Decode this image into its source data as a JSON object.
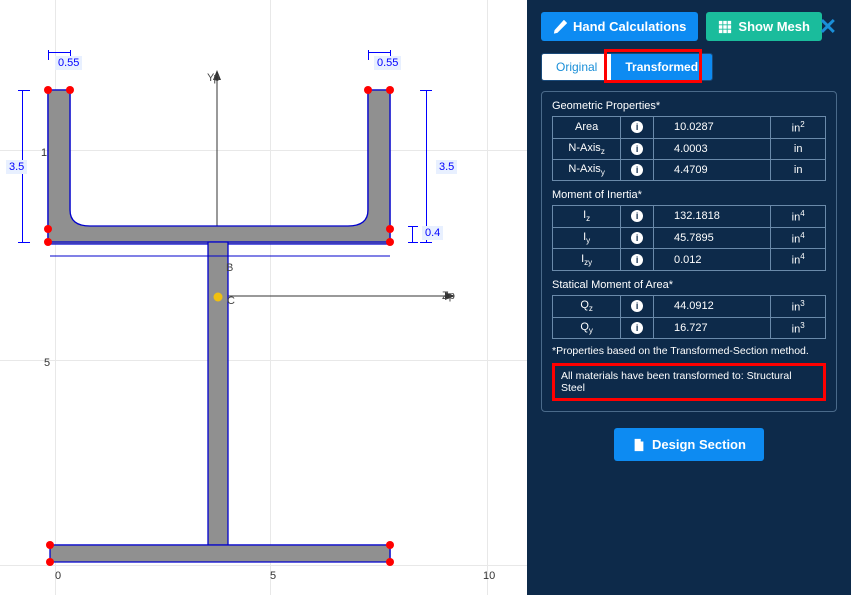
{
  "buttons": {
    "hand_calc": "Hand Calculations",
    "show_mesh": "Show Mesh",
    "design_section": "Design Section"
  },
  "tabs": {
    "original": "Original",
    "transformed": "Transformed"
  },
  "sections": {
    "geometric": {
      "title": "Geometric Properties*",
      "rows": [
        {
          "label": "Area",
          "value": "10.0287",
          "unit": "in²"
        },
        {
          "label": "N-Axis",
          "sub": "z",
          "value": "4.0003",
          "unit": "in"
        },
        {
          "label": "N-Axis",
          "sub": "y",
          "value": "4.4709",
          "unit": "in"
        }
      ]
    },
    "inertia": {
      "title": "Moment of Inertia*",
      "rows": [
        {
          "label": "I",
          "sub": "z",
          "value": "132.1818",
          "unit": "in⁴"
        },
        {
          "label": "I",
          "sub": "y",
          "value": "45.7895",
          "unit": "in⁴"
        },
        {
          "label": "I",
          "sub": "zy",
          "value": "0.012",
          "unit": "in⁴"
        }
      ]
    },
    "statical": {
      "title": "Statical Moment of Area*",
      "rows": [
        {
          "label": "Q",
          "sub": "z",
          "value": "44.0912",
          "unit": "in³"
        },
        {
          "label": "Q",
          "sub": "y",
          "value": "16.727",
          "unit": "in³"
        }
      ]
    }
  },
  "notes": {
    "method": "*Properties based on the Transformed-Section method.",
    "transform": "All materials have been transformed to: Structural Steel"
  },
  "canvas": {
    "axes": {
      "yp": "Yp",
      "zp": "Zp",
      "c": "C",
      "b": "B"
    },
    "ticks": {
      "x0": "0",
      "x5": "5",
      "x10": "10",
      "y5": "5",
      "y10": "10"
    },
    "dims": {
      "top_left": "0.55",
      "top_right": "0.55",
      "left": "3.5",
      "right": "3.5",
      "mid_right": "0.4"
    }
  }
}
